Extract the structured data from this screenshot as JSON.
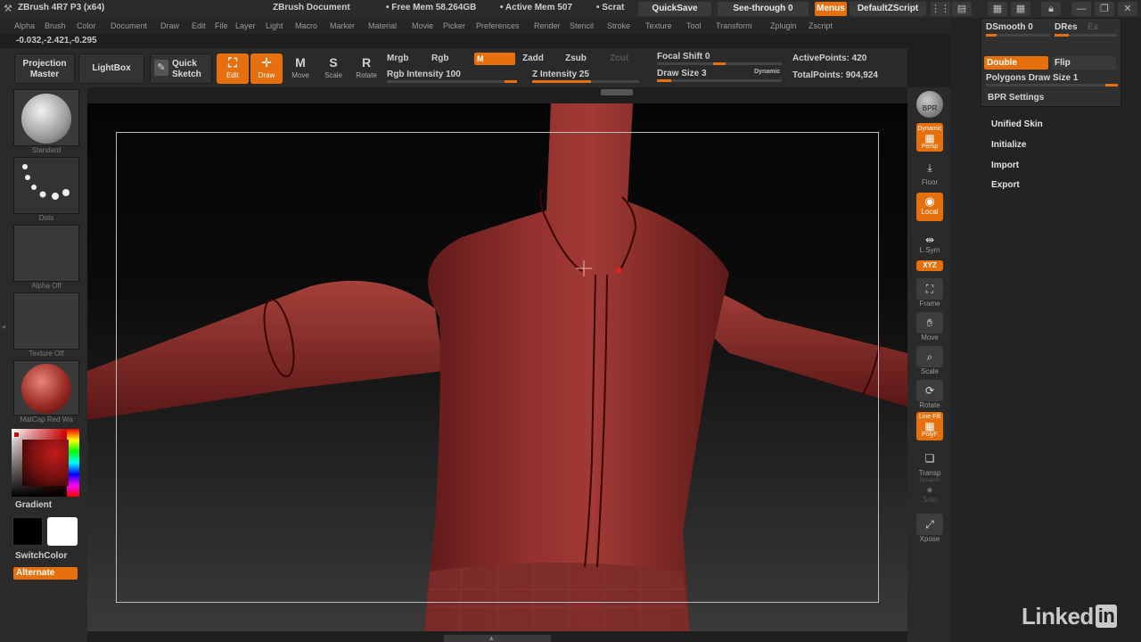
{
  "titlebar": {
    "app_title": "ZBrush 4R7 P3 (x64)",
    "document": "ZBrush Document",
    "free_mem": "• Free Mem 58.264GB",
    "active_mem": "• Active Mem 507",
    "scratch": "• Scrat",
    "quicksave": "QuickSave",
    "see_through": "See-through",
    "see_through_value": "0",
    "menus": "Menus",
    "default_zscript": "DefaultZScript"
  },
  "menubar": {
    "items": [
      "Alpha",
      "Brush",
      "Color",
      "Document",
      "Draw",
      "Edit",
      "File",
      "Layer",
      "Light",
      "Macro",
      "Marker",
      "Material",
      "Movie",
      "Picker",
      "Preferences",
      "Render",
      "Stencil",
      "Stroke",
      "Texture",
      "Tool",
      "Transform",
      "Zplugin",
      "Zscript"
    ]
  },
  "coords": "-0.032,-2.421,-0.295",
  "toolbar": {
    "projection_master": "Projection Master",
    "projection_line1": "Projection",
    "projection_line2": "Master",
    "lightbox": "LightBox",
    "quick_sketch_1": "Quick",
    "quick_sketch_2": "Sketch",
    "edit": "Edit",
    "draw": "Draw",
    "move": "Move",
    "scale": "Scale",
    "rotate": "Rotate",
    "mrgb": "Mrgb",
    "rgb": "Rgb",
    "m": "M",
    "zadd": "Zadd",
    "zsub": "Zsub",
    "zcut": "Zcut",
    "rgb_intensity": "Rgb Intensity 100",
    "z_intensity": "Z Intensity 25",
    "focal_shift": "Focal Shift 0",
    "draw_size": "Draw Size 3",
    "dynamic": "Dynamic",
    "active_points": "ActivePoints: 420",
    "total_points": "TotalPoints: 904,924"
  },
  "left_shelf": {
    "brush": "Standard",
    "stroke": "Dots",
    "alpha": "Alpha Off",
    "texture": "Texture Off",
    "material": "MatCap Red Wa",
    "gradient": "Gradient",
    "switch_color": "SwitchColor",
    "alternate": "Alternate"
  },
  "right_shelf": {
    "bpr": "BPR",
    "dynamic": "Dynamic",
    "persp": "Persp",
    "floor": "Floor",
    "local": "Local",
    "lsym": "L.Sym",
    "xyz": "XYZ",
    "frame": "Frame",
    "move": "Move",
    "scale": "Scale",
    "rotate": "Rotate",
    "line_fill": "Line Fill",
    "polyf": "PolyF",
    "transp": "Transp",
    "solo_dynamic": "Dynamic",
    "solo": "Solo",
    "xpose": "Xpose"
  },
  "right_panel": {
    "dsmooth": "DSmooth 0",
    "dres": "DRes",
    "dres_extra": "Ex",
    "double": "Double",
    "flip": "Flip",
    "polygons_draw_size": "Polygons Draw Size 1",
    "bpr_settings": "BPR Settings",
    "unified_skin": "Unified Skin",
    "initialize": "Initialize",
    "import": "Import",
    "export": "Export"
  },
  "watermark": {
    "linked": "Linked",
    "in": "in"
  },
  "colors": {
    "accent": "#e5700d",
    "model": "#8a2a28",
    "background": "#1f1f1f"
  }
}
